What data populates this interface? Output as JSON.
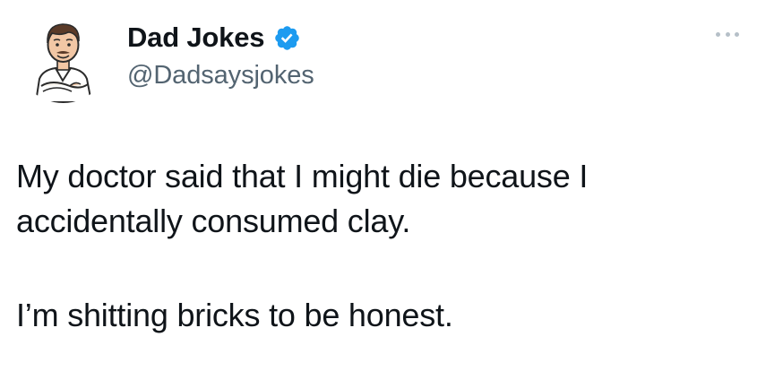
{
  "author": {
    "display_name": "Dad Jokes",
    "handle": "@Dadsaysjokes",
    "verified": true,
    "avatar_icon": "cartoon-dad-avatar",
    "verified_color": "#1d9bf0"
  },
  "menu": {
    "icon": "more-options-icon"
  },
  "tweet": {
    "paragraph_1": "My doctor said that I might die because I\naccidentally consumed clay.",
    "paragraph_2": "I’m shitting bricks to be honest."
  },
  "colors": {
    "text": "#0f1419",
    "secondary": "#536471",
    "accent": "#1d9bf0"
  }
}
